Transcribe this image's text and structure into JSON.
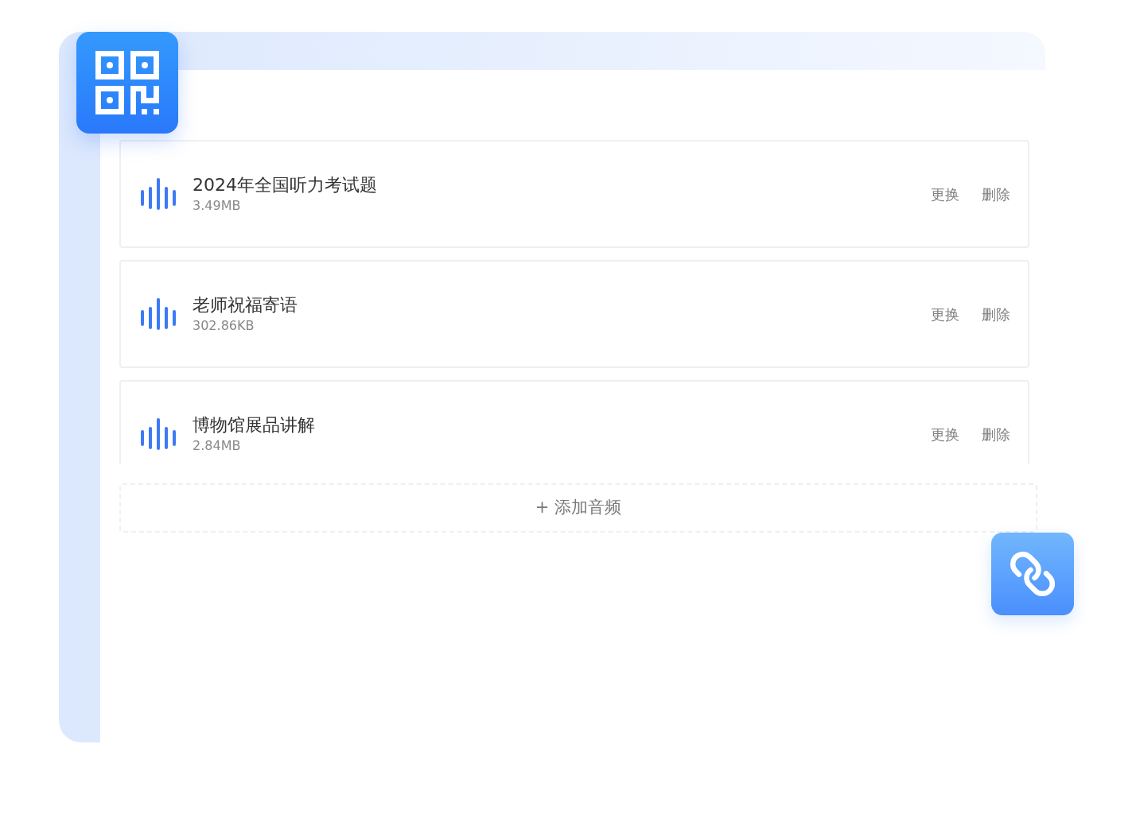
{
  "audio_list": [
    {
      "title": "2024年全国听力考试题",
      "size": "3.49MB",
      "actions": [
        "更换",
        "删除"
      ]
    },
    {
      "title": "老师祝福寄语",
      "size": "302.86KB",
      "actions": [
        "更换",
        "删除"
      ]
    },
    {
      "title": "博物馆展品讲解",
      "size": "2.84MB",
      "actions": [
        "更换",
        "删除"
      ]
    }
  ],
  "add_button": "+ 添加音频"
}
